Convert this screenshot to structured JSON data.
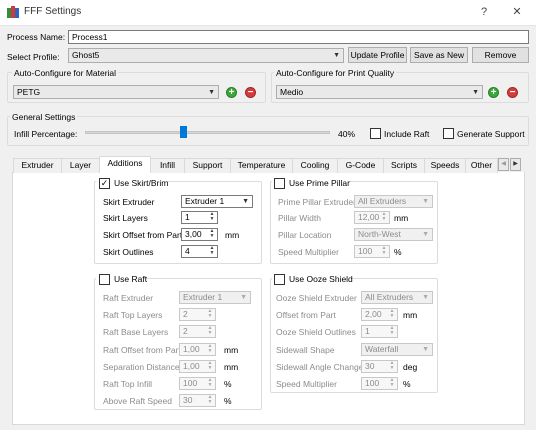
{
  "window": {
    "title": "FFF Settings",
    "help": "?",
    "close": "✕"
  },
  "process": {
    "label": "Process Name:",
    "value": "Process1"
  },
  "profile": {
    "label": "Select Profile:",
    "value": "Ghost5",
    "update": "Update Profile",
    "save_as_new": "Save as New",
    "remove": "Remove"
  },
  "material": {
    "title": "Auto-Configure for Material",
    "value": "PETG",
    "add": "+",
    "remove": "−"
  },
  "quality": {
    "title": "Auto-Configure for Print Quality",
    "value": "Medio",
    "add": "+",
    "remove": "−"
  },
  "general": {
    "title": "General Settings",
    "infill_label": "Infill Percentage:",
    "infill_value": "40%",
    "infill_fraction": 0.4,
    "include_raft": "Include Raft",
    "generate_support": "Generate Support"
  },
  "tabs": [
    "Extruder",
    "Layer",
    "Additions",
    "Infill",
    "Support",
    "Temperature",
    "Cooling",
    "G-Code",
    "Scripts",
    "Speeds",
    "Other"
  ],
  "active_tab": "Additions",
  "skirt": {
    "title": "Use Skirt/Brim",
    "checked": "✓",
    "extruder_label": "Skirt Extruder",
    "extruder_value": "Extruder 1",
    "layers_label": "Skirt Layers",
    "layers_value": "1",
    "offset_label": "Skirt Offset from Part",
    "offset_value": "3,00",
    "offset_unit": "mm",
    "outlines_label": "Skirt Outlines",
    "outlines_value": "4"
  },
  "prime": {
    "title": "Use Prime Pillar",
    "extruder_label": "Prime Pillar Extruder",
    "extruder_value": "All Extruders",
    "width_label": "Pillar Width",
    "width_value": "12,00",
    "width_unit": "mm",
    "location_label": "Pillar Location",
    "location_value": "North-West",
    "speed_label": "Speed Multiplier",
    "speed_value": "100",
    "speed_unit": "%"
  },
  "raft": {
    "title": "Use Raft",
    "extruder_label": "Raft Extruder",
    "extruder_value": "Extruder 1",
    "top_label": "Raft Top Layers",
    "top_value": "2",
    "base_label": "Raft Base Layers",
    "base_value": "2",
    "offset_label": "Raft Offset from Part",
    "offset_value": "1,00",
    "offset_unit": "mm",
    "separation_label": "Separation Distance",
    "separation_value": "1,00",
    "separation_unit": "mm",
    "infill_label": "Raft Top Infill",
    "infill_value": "100",
    "infill_unit": "%",
    "speed_label": "Above Raft Speed",
    "speed_value": "30",
    "speed_unit": "%"
  },
  "ooze": {
    "title": "Use Ooze Shield",
    "extruder_label": "Ooze Shield Extruder",
    "extruder_value": "All Extruders",
    "offset_label": "Offset from Part",
    "offset_value": "2,00",
    "offset_unit": "mm",
    "outlines_label": "Ooze Shield Outlines",
    "outlines_value": "1",
    "shape_label": "Sidewall Shape",
    "shape_value": "Waterfall",
    "angle_label": "Sidewall Angle Change",
    "angle_value": "30",
    "angle_unit": "deg",
    "speed_label": "Speed Multiplier",
    "speed_value": "100",
    "speed_unit": "%"
  }
}
